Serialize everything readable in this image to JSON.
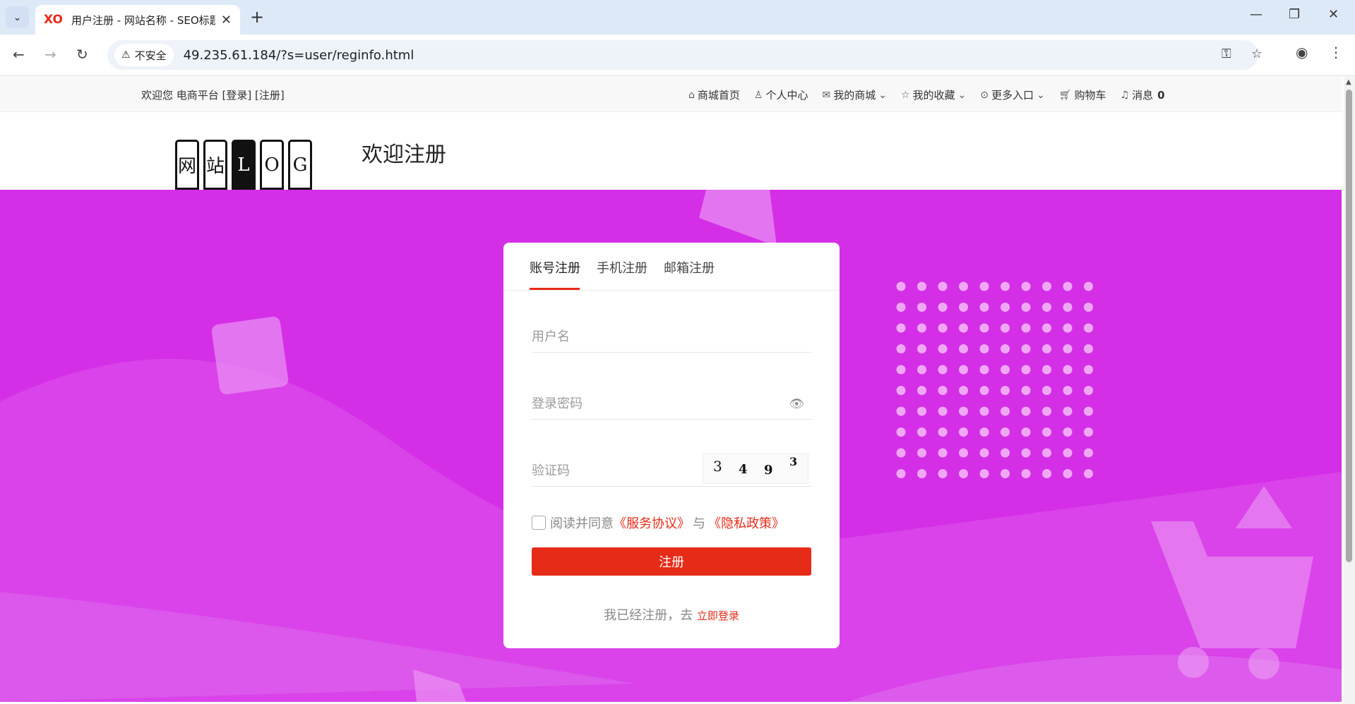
{
  "browser": {
    "tab_title": "用户注册 - 网站名称 - SEO标题",
    "favicon_text": "XO",
    "security_label": "不安全",
    "url": "49.235.61.184/?s=user/reginfo.html"
  },
  "topbar": {
    "welcome": "欢迎您 电商平台 [登录] [注册]",
    "nav": [
      {
        "label": "商城首页",
        "icon": "home-icon"
      },
      {
        "label": "个人中心",
        "icon": "user-icon"
      },
      {
        "label": "我的商城",
        "icon": "mail-icon"
      },
      {
        "label": "我的收藏",
        "icon": "star-icon"
      },
      {
        "label": "更多入口",
        "icon": "more-icon"
      },
      {
        "label": "购物车",
        "icon": "cart-icon"
      },
      {
        "label": "消息",
        "icon": "bell-icon"
      }
    ],
    "message_count": "0"
  },
  "header": {
    "logo_chars": [
      "网",
      "站",
      "L",
      "O",
      "G"
    ],
    "title": "欢迎注册"
  },
  "register": {
    "tabs": [
      "账号注册",
      "手机注册",
      "邮箱注册"
    ],
    "username_placeholder": "用户名",
    "password_placeholder": "登录密码",
    "captcha_placeholder": "验证码",
    "captcha_chars": [
      "3",
      "4",
      "9",
      "3"
    ],
    "agree_prefix": "阅读并同意",
    "service_agreement": "《服务协议》",
    "agree_and": "与",
    "privacy_policy": "《隐私政策》",
    "submit_label": "注册",
    "login_prefix": "我已经注册，去",
    "login_link": "立即登录"
  },
  "colors": {
    "accent": "#e62b19",
    "hero_bg": "#d42fe7"
  }
}
